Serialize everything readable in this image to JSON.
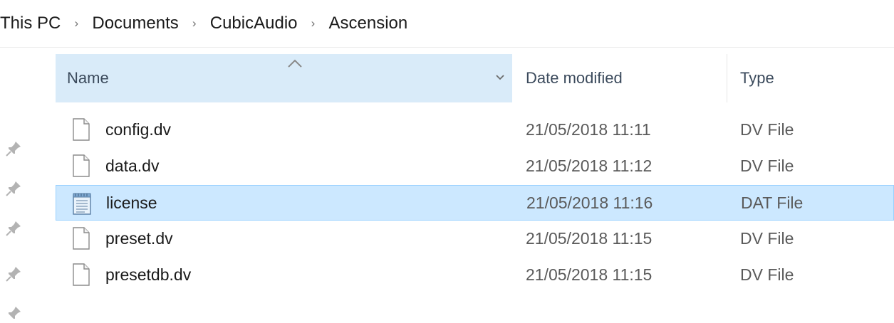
{
  "breadcrumb": {
    "items": [
      "This PC",
      "Documents",
      "CubicAudio",
      "Ascension"
    ],
    "separator": "›"
  },
  "columns": {
    "name": "Name",
    "date_modified": "Date modified",
    "type": "Type"
  },
  "sort": {
    "column": "Name",
    "direction": "ascending"
  },
  "files": [
    {
      "name": "config.dv",
      "date": "21/05/2018 11:11",
      "type": "DV File",
      "icon": "blank-document-icon",
      "selected": false
    },
    {
      "name": "data.dv",
      "date": "21/05/2018 11:12",
      "type": "DV File",
      "icon": "blank-document-icon",
      "selected": false
    },
    {
      "name": "license",
      "date": "21/05/2018 11:16",
      "type": "DAT File",
      "icon": "notepad-document-icon",
      "selected": true
    },
    {
      "name": "preset.dv",
      "date": "21/05/2018 11:15",
      "type": "DV File",
      "icon": "blank-document-icon",
      "selected": false
    },
    {
      "name": "presetdb.dv",
      "date": "21/05/2018 11:15",
      "type": "DV File",
      "icon": "blank-document-icon",
      "selected": false
    }
  ],
  "colors": {
    "header_highlight": "#d9ebf9",
    "selection_fill": "#cce8ff",
    "selection_border": "#99d1ff"
  }
}
